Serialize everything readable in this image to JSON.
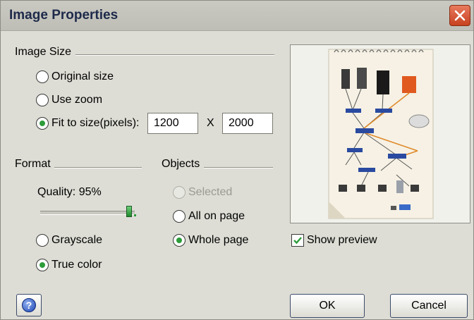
{
  "window": {
    "title": "Image Properties"
  },
  "image_size": {
    "heading": "Image Size",
    "options": [
      {
        "label": "Original size",
        "checked": false
      },
      {
        "label": "Use zoom",
        "checked": false
      },
      {
        "label": "Fit to size(pixels):",
        "checked": true
      }
    ],
    "width_value": "1200",
    "separator": "X",
    "height_value": "2000"
  },
  "format": {
    "heading": "Format",
    "quality_label": "Quality: 95%",
    "quality_fraction": 0.95,
    "options": [
      {
        "label": "Grayscale",
        "checked": false
      },
      {
        "label": "True color",
        "checked": true
      }
    ]
  },
  "objects": {
    "heading": "Objects",
    "options": [
      {
        "label": "Selected",
        "checked": false,
        "disabled": true
      },
      {
        "label": "All on page",
        "checked": false
      },
      {
        "label": "Whole page",
        "checked": true
      }
    ]
  },
  "preview": {
    "show_label": "Show preview",
    "show_checked": true
  },
  "buttons": {
    "ok": "OK",
    "cancel": "Cancel",
    "help_icon": "help-icon",
    "close_icon": "close-icon"
  },
  "colors": {
    "accent_green": "#2d9c3a",
    "close_red": "#d04a24",
    "dialog_bg": "#ddddd5"
  }
}
